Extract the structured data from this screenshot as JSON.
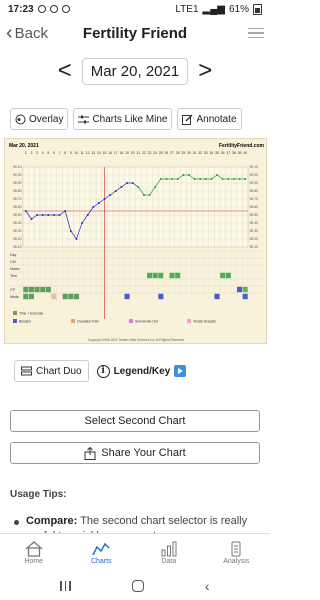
{
  "status": {
    "time": "17:23",
    "network": "LTE1",
    "battery": "61%"
  },
  "header": {
    "back_label": "Back",
    "title": "Fertility Friend"
  },
  "date_nav": {
    "date": "Mar 20, 2021"
  },
  "toolbar": {
    "overlay": "Overlay",
    "charts_like_mine": "Charts Like Mine",
    "annotate": "Annotate"
  },
  "chart": {
    "date_label": "Mar 20, 2021",
    "site": "FertilityFriend.com",
    "copyright": "Copyright 1998-2021 Tamtris Web Services Inc. All Rights Reserved",
    "row_labels": [
      "Day",
      "CM",
      "Notes",
      "Test",
      "",
      "CP",
      "Meds"
    ],
    "y_ticks_left": [
      "99.10",
      "99.00",
      "98.90",
      "98.80",
      "98.70",
      "98.60",
      "98.50",
      "98.40",
      "98.30",
      "98.20",
      "98.10"
    ],
    "legend": [
      "Time + Exercise",
      "Bloated",
      "Ovulation Pain",
      "Skin Broke Out",
      "Tender Breasts"
    ],
    "colors": {
      "pre_line": "#2233bb",
      "post_line": "#2e9e3a",
      "coverline": "#cc2222",
      "ovulation": "#cc2222"
    }
  },
  "chart_data": {
    "type": "line",
    "title": "",
    "xlabel": "Day",
    "ylabel": "",
    "x": [
      1,
      2,
      3,
      4,
      5,
      6,
      7,
      8,
      9,
      10,
      11,
      12,
      13,
      14,
      15,
      16,
      17,
      18,
      19,
      20,
      21,
      22,
      23,
      24,
      25,
      26,
      27,
      28,
      29,
      30,
      31,
      32,
      33,
      34,
      35,
      36,
      37,
      38,
      39,
      40
    ],
    "series": [
      {
        "values": [
          98.55,
          98.45,
          98.5,
          98.5,
          98.5,
          98.5,
          98.5,
          98.55,
          98.3,
          98.2,
          98.4,
          98.5,
          98.6,
          98.65,
          98.7,
          98.75,
          98.8,
          98.85,
          98.9,
          98.9,
          98.85,
          98.75,
          98.75,
          98.85,
          98.95,
          98.95,
          98.95,
          98.95,
          99.0,
          99.0,
          98.95,
          98.95,
          98.95,
          98.95,
          99.0,
          98.95,
          98.95,
          98.95,
          98.95,
          98.95
        ]
      }
    ],
    "coverline": 98.55,
    "ovulation_day": 15,
    "ylim": [
      98.1,
      99.1
    ]
  },
  "chart_tools": {
    "chart_duo": "Chart Duo",
    "legend": "Legend/Key"
  },
  "actions": {
    "select_second": "Select Second Chart",
    "share": "Share Your Chart"
  },
  "tips": {
    "title": "Usage Tips:",
    "item_bold": "Compare:",
    "item_text": " The second chart selector is really useful to quickly compare two"
  },
  "tabs": [
    {
      "label": "Home",
      "icon": "home-icon"
    },
    {
      "label": "Charts",
      "icon": "charts-icon"
    },
    {
      "label": "Data",
      "icon": "data-icon"
    },
    {
      "label": "Analysis",
      "icon": "analysis-icon"
    }
  ]
}
